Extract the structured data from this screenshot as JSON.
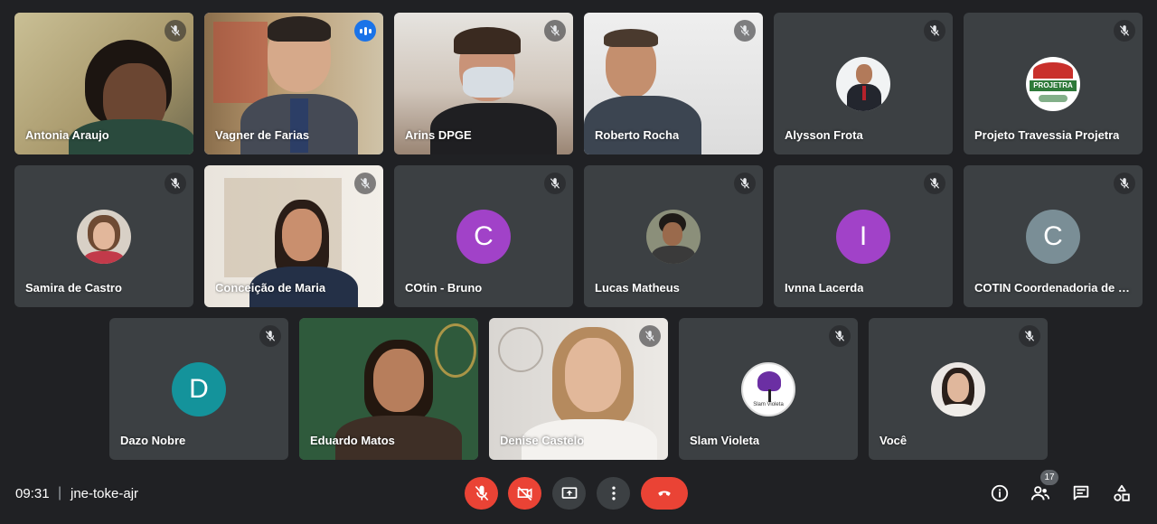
{
  "meeting": {
    "time": "09:31",
    "separator": "|",
    "code": "jne-toke-ajr"
  },
  "participants_count": "17",
  "tiles": [
    {
      "name": "Antonia Araujo",
      "type": "video",
      "muted": true
    },
    {
      "name": "Vagner de Farias",
      "type": "video",
      "speaking": true
    },
    {
      "name": "Arins DPGE",
      "type": "video",
      "muted": true
    },
    {
      "name": "Roberto Rocha",
      "type": "video",
      "muted": true
    },
    {
      "name": "Alysson Frota",
      "type": "photo",
      "muted": true
    },
    {
      "name": "Projeto Travessia Projetra",
      "type": "photo",
      "muted": true,
      "logo_text": "PROJETRA"
    },
    {
      "name": "Samira de Castro",
      "type": "photo",
      "muted": true
    },
    {
      "name": "Conceição de Maria",
      "type": "video",
      "muted": true
    },
    {
      "name": "COtin - Bruno",
      "type": "letter",
      "letter": "C",
      "color": "#a142c8",
      "muted": true
    },
    {
      "name": "Lucas Matheus",
      "type": "photo",
      "muted": true
    },
    {
      "name": "Ivnna Lacerda",
      "type": "letter",
      "letter": "I",
      "color": "#a142c8",
      "muted": true
    },
    {
      "name": "COTIN Coordenadoria de T...",
      "type": "letter",
      "letter": "C",
      "color": "#7a8e96",
      "muted": true
    },
    {
      "name": "Dazo Nobre",
      "type": "letter",
      "letter": "D",
      "color": "#14939b",
      "muted": true
    },
    {
      "name": "Eduardo Matos",
      "type": "video"
    },
    {
      "name": "Denise Castelo",
      "type": "video",
      "muted": true
    },
    {
      "name": "Slam Violeta",
      "type": "photo",
      "muted": true,
      "logo_text": "Slam Violeta"
    },
    {
      "name": "Você",
      "type": "photo",
      "muted": true
    }
  ],
  "colors": {
    "background": "#202124",
    "tile": "#3c4043",
    "end_call": "#ea4335",
    "active_outline": "#8ab4f8"
  }
}
